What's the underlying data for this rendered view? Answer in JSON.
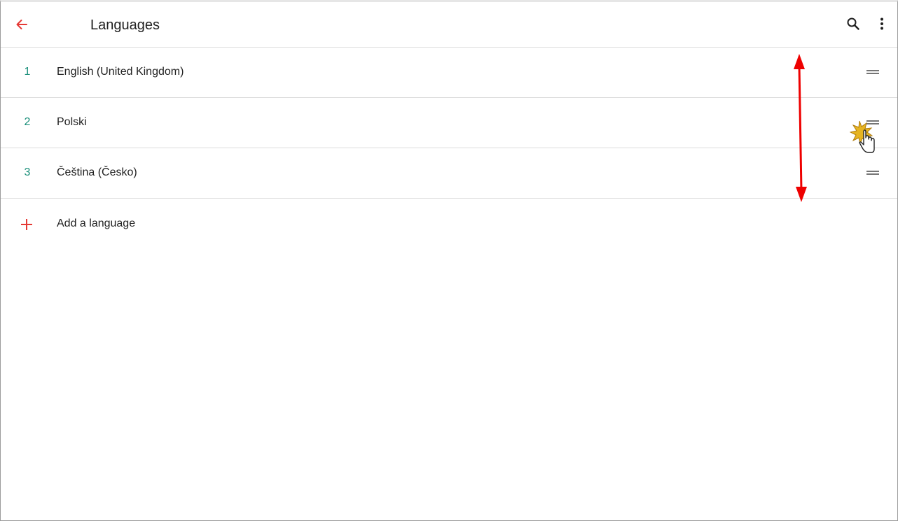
{
  "appbar": {
    "title": "Languages",
    "back_icon": "arrow-back-icon",
    "search_icon": "search-icon",
    "more_icon": "more-vert-icon"
  },
  "languages": [
    {
      "index": "1",
      "name": "English (United Kingdom)"
    },
    {
      "index": "2",
      "name": "Polski"
    },
    {
      "index": "3",
      "name": "Čeština (Česko)"
    }
  ],
  "add_language": {
    "label": "Add a language",
    "icon": "plus-icon"
  },
  "colors": {
    "accent": "#e53935",
    "index_teal": "#1a8f7a",
    "annotation_arrow": "#ee0000"
  }
}
